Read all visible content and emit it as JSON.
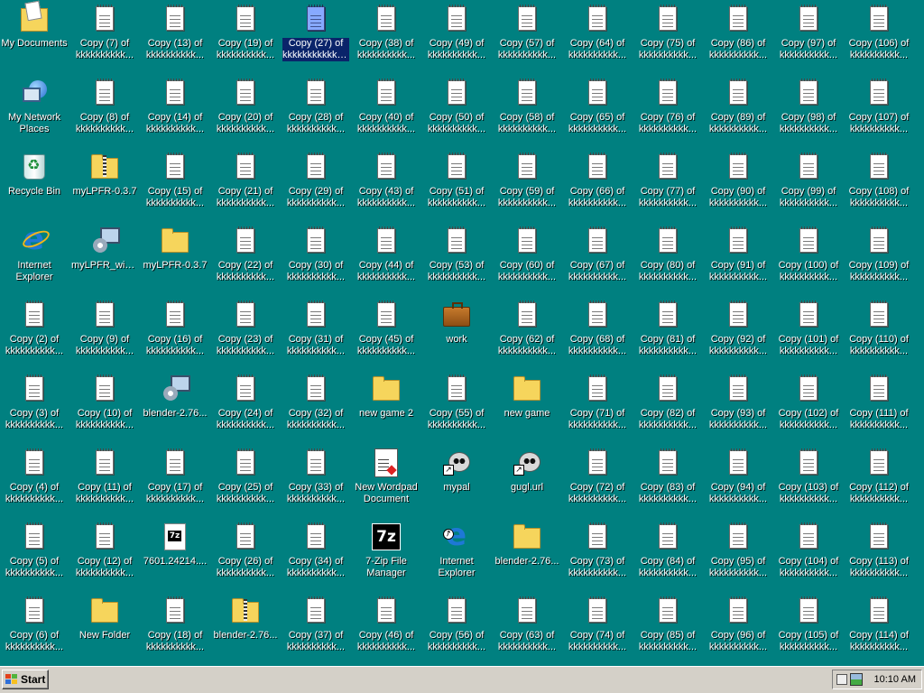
{
  "desktop": {
    "columns": [
      [
        {
          "label": "My Documents",
          "icon": "my-documents-icon"
        },
        {
          "label": "My Network Places",
          "icon": "network-places-icon"
        },
        {
          "label": "Recycle Bin",
          "icon": "recycle-bin-icon"
        },
        {
          "label": "Internet Explorer",
          "icon": "internet-explorer-icon"
        },
        {
          "label": "Copy (2) of kkkkkkkkkk...",
          "icon": "text-document-icon"
        },
        {
          "label": "Copy (3) of kkkkkkkkkk...",
          "icon": "text-document-icon"
        },
        {
          "label": "Copy (4) of kkkkkkkkkk...",
          "icon": "text-document-icon"
        },
        {
          "label": "Copy (5) of kkkkkkkkkk...",
          "icon": "text-document-icon"
        },
        {
          "label": "Copy (6) of kkkkkkkkkk...",
          "icon": "text-document-icon"
        }
      ],
      [
        {
          "label": "Copy (7) of kkkkkkkkkk...",
          "icon": "text-document-icon"
        },
        {
          "label": "Copy (8) of kkkkkkkkkk...",
          "icon": "text-document-icon"
        },
        {
          "label": "myLPFR-0.3.7",
          "icon": "zip-folder-icon"
        },
        {
          "label": "myLPFR_win...",
          "icon": "setup-program-icon"
        },
        {
          "label": "Copy (9) of kkkkkkkkkk...",
          "icon": "text-document-icon"
        },
        {
          "label": "Copy (10) of kkkkkkkkkk...",
          "icon": "text-document-icon"
        },
        {
          "label": "Copy (11) of kkkkkkkkkk...",
          "icon": "text-document-icon"
        },
        {
          "label": "Copy (12) of kkkkkkkkkk...",
          "icon": "text-document-icon"
        },
        {
          "label": "New Folder",
          "icon": "folder-icon"
        }
      ],
      [
        {
          "label": "Copy (13) of kkkkkkkkkk...",
          "icon": "text-document-icon"
        },
        {
          "label": "Copy (14) of kkkkkkkkkk...",
          "icon": "text-document-icon"
        },
        {
          "label": "Copy (15) of kkkkkkkkkk...",
          "icon": "text-document-icon"
        },
        {
          "label": "myLPFR-0.3.7",
          "icon": "folder-icon"
        },
        {
          "label": "Copy (16) of kkkkkkkkkk...",
          "icon": "text-document-icon"
        },
        {
          "label": "blender-2.76...",
          "icon": "setup-program-icon"
        },
        {
          "label": "Copy (17) of kkkkkkkkkk...",
          "icon": "text-document-icon"
        },
        {
          "label": "7601.24214....",
          "icon": "7z-archive-icon"
        },
        {
          "label": "Copy (18) of kkkkkkkkkk...",
          "icon": "text-document-icon"
        }
      ],
      [
        {
          "label": "Copy (19) of kkkkkkkkkk...",
          "icon": "text-document-icon"
        },
        {
          "label": "Copy (20) of kkkkkkkkkk...",
          "icon": "text-document-icon"
        },
        {
          "label": "Copy (21) of kkkkkkkkkk...",
          "icon": "text-document-icon"
        },
        {
          "label": "Copy (22) of kkkkkkkkkk...",
          "icon": "text-document-icon"
        },
        {
          "label": "Copy (23) of kkkkkkkkkk...",
          "icon": "text-document-icon"
        },
        {
          "label": "Copy (24) of kkkkkkkkkk...",
          "icon": "text-document-icon"
        },
        {
          "label": "Copy (25) of kkkkkkkkkk...",
          "icon": "text-document-icon"
        },
        {
          "label": "Copy (26) of kkkkkkkkkk...",
          "icon": "text-document-icon"
        },
        {
          "label": "blender-2.76...",
          "icon": "zip-folder-icon"
        }
      ],
      [
        {
          "label": "Copy (27) of kkkkkkkkkkkk kkkkkkkkkkkk",
          "icon": "text-document-icon",
          "selected": true
        },
        {
          "label": "Copy (28) of kkkkkkkkkk...",
          "icon": "text-document-icon"
        },
        {
          "label": "Copy (29) of kkkkkkkkkk...",
          "icon": "text-document-icon"
        },
        {
          "label": "Copy (30) of kkkkkkkkkk...",
          "icon": "text-document-icon"
        },
        {
          "label": "Copy (31) of kkkkkkkkkk...",
          "icon": "text-document-icon"
        },
        {
          "label": "Copy (32) of kkkkkkkkkk...",
          "icon": "text-document-icon"
        },
        {
          "label": "Copy (33) of kkkkkkkkkk...",
          "icon": "text-document-icon"
        },
        {
          "label": "Copy (34) of kkkkkkkkkk...",
          "icon": "text-document-icon"
        },
        {
          "label": "Copy (37) of kkkkkkkkkk...",
          "icon": "text-document-icon"
        }
      ],
      [
        {
          "label": "Copy (38) of kkkkkkkkkk...",
          "icon": "text-document-icon"
        },
        {
          "label": "Copy (40) of kkkkkkkkkk...",
          "icon": "text-document-icon"
        },
        {
          "label": "Copy (43) of kkkkkkkkkk...",
          "icon": "text-document-icon"
        },
        {
          "label": "Copy (44) of kkkkkkkkkk...",
          "icon": "text-document-icon"
        },
        {
          "label": "Copy (45) of kkkkkkkkkk...",
          "icon": "text-document-icon"
        },
        {
          "label": "new game 2",
          "icon": "folder-icon"
        },
        {
          "label": "New Wordpad Document",
          "icon": "wordpad-document-icon"
        },
        {
          "label": "7-Zip File Manager",
          "icon": "7zip-icon"
        },
        {
          "label": "Copy (46) of kkkkkkkkkk...",
          "icon": "text-document-icon"
        }
      ],
      [
        {
          "label": "Copy (49) of kkkkkkkkkk...",
          "icon": "text-document-icon"
        },
        {
          "label": "Copy (50) of kkkkkkkkkk...",
          "icon": "text-document-icon"
        },
        {
          "label": "Copy (51) of kkkkkkkkkk...",
          "icon": "text-document-icon"
        },
        {
          "label": "Copy (53) of kkkkkkkkkk...",
          "icon": "text-document-icon"
        },
        {
          "label": "work",
          "icon": "briefcase-icon"
        },
        {
          "label": "Copy (55) of kkkkkkkkkk...",
          "icon": "text-document-icon"
        },
        {
          "label": "mypal",
          "icon": "mypal-shortcut-icon"
        },
        {
          "label": "Internet Explorer",
          "icon": "internet-explorer-shortcut-icon"
        },
        {
          "label": "Copy (56) of kkkkkkkkkk...",
          "icon": "text-document-icon"
        }
      ],
      [
        {
          "label": "Copy (57) of kkkkkkkkkk...",
          "icon": "text-document-icon"
        },
        {
          "label": "Copy (58) of kkkkkkkkkk...",
          "icon": "text-document-icon"
        },
        {
          "label": "Copy (59) of kkkkkkkkkk...",
          "icon": "text-document-icon"
        },
        {
          "label": "Copy (60) of kkkkkkkkkk...",
          "icon": "text-document-icon"
        },
        {
          "label": "Copy (62) of kkkkkkkkkk...",
          "icon": "text-document-icon"
        },
        {
          "label": "new game",
          "icon": "folder-icon"
        },
        {
          "label": "gugl.url",
          "icon": "url-shortcut-icon"
        },
        {
          "label": "blender-2.76...",
          "icon": "folder-icon"
        },
        {
          "label": "Copy (63) of kkkkkkkkkk...",
          "icon": "text-document-icon"
        }
      ],
      [
        {
          "label": "Copy (64) of kkkkkkkkkk...",
          "icon": "text-document-icon"
        },
        {
          "label": "Copy (65) of kkkkkkkkkk...",
          "icon": "text-document-icon"
        },
        {
          "label": "Copy (66) of kkkkkkkkkk...",
          "icon": "text-document-icon"
        },
        {
          "label": "Copy (67) of kkkkkkkkkk...",
          "icon": "text-document-icon"
        },
        {
          "label": "Copy (68) of kkkkkkkkkk...",
          "icon": "text-document-icon"
        },
        {
          "label": "Copy (71) of kkkkkkkkkk...",
          "icon": "text-document-icon"
        },
        {
          "label": "Copy (72) of kkkkkkkkkk...",
          "icon": "text-document-icon"
        },
        {
          "label": "Copy (73) of kkkkkkkkkk...",
          "icon": "text-document-icon"
        },
        {
          "label": "Copy (74) of kkkkkkkkkk...",
          "icon": "text-document-icon"
        }
      ],
      [
        {
          "label": "Copy (75) of kkkkkkkkkk...",
          "icon": "text-document-icon"
        },
        {
          "label": "Copy (76) of kkkkkkkkkk...",
          "icon": "text-document-icon"
        },
        {
          "label": "Copy (77) of kkkkkkkkkk...",
          "icon": "text-document-icon"
        },
        {
          "label": "Copy (80) of kkkkkkkkkk...",
          "icon": "text-document-icon"
        },
        {
          "label": "Copy (81) of kkkkkkkkkk...",
          "icon": "text-document-icon"
        },
        {
          "label": "Copy (82) of kkkkkkkkkk...",
          "icon": "text-document-icon"
        },
        {
          "label": "Copy (83) of kkkkkkkkkk...",
          "icon": "text-document-icon"
        },
        {
          "label": "Copy (84) of kkkkkkkkkk...",
          "icon": "text-document-icon"
        },
        {
          "label": "Copy (85) of kkkkkkkkkk...",
          "icon": "text-document-icon"
        }
      ],
      [
        {
          "label": "Copy (86) of kkkkkkkkkk...",
          "icon": "text-document-icon"
        },
        {
          "label": "Copy (89) of kkkkkkkkkk...",
          "icon": "text-document-icon"
        },
        {
          "label": "Copy (90) of kkkkkkkkkk...",
          "icon": "text-document-icon"
        },
        {
          "label": "Copy (91) of kkkkkkkkkk...",
          "icon": "text-document-icon"
        },
        {
          "label": "Copy (92) of kkkkkkkkkk...",
          "icon": "text-document-icon"
        },
        {
          "label": "Copy (93) of kkkkkkkkkk...",
          "icon": "text-document-icon"
        },
        {
          "label": "Copy (94) of kkkkkkkkkk...",
          "icon": "text-document-icon"
        },
        {
          "label": "Copy (95) of kkkkkkkkkk...",
          "icon": "text-document-icon"
        },
        {
          "label": "Copy (96) of kkkkkkkkkk...",
          "icon": "text-document-icon"
        }
      ],
      [
        {
          "label": "Copy (97) of kkkkkkkkkk...",
          "icon": "text-document-icon"
        },
        {
          "label": "Copy (98) of kkkkkkkkkk...",
          "icon": "text-document-icon"
        },
        {
          "label": "Copy (99) of kkkkkkkkkk...",
          "icon": "text-document-icon"
        },
        {
          "label": "Copy (100) of kkkkkkkkkk...",
          "icon": "text-document-icon"
        },
        {
          "label": "Copy (101) of kkkkkkkkkk...",
          "icon": "text-document-icon"
        },
        {
          "label": "Copy (102) of kkkkkkkkkk...",
          "icon": "text-document-icon"
        },
        {
          "label": "Copy (103) of kkkkkkkkkk...",
          "icon": "text-document-icon"
        },
        {
          "label": "Copy (104) of kkkkkkkkkk...",
          "icon": "text-document-icon"
        },
        {
          "label": "Copy (105) of kkkkkkkkkk...",
          "icon": "text-document-icon"
        }
      ],
      [
        {
          "label": "Copy (106) of kkkkkkkkkk...",
          "icon": "text-document-icon"
        },
        {
          "label": "Copy (107) of kkkkkkkkkk...",
          "icon": "text-document-icon"
        },
        {
          "label": "Copy (108) of kkkkkkkkkk...",
          "icon": "text-document-icon"
        },
        {
          "label": "Copy (109) of kkkkkkkkkk...",
          "icon": "text-document-icon"
        },
        {
          "label": "Copy (110) of kkkkkkkkkk...",
          "icon": "text-document-icon"
        },
        {
          "label": "Copy (111) of kkkkkkkkkk...",
          "icon": "text-document-icon"
        },
        {
          "label": "Copy (112) of kkkkkkkkkk...",
          "icon": "text-document-icon"
        },
        {
          "label": "Copy (113) of kkkkkkkkkk...",
          "icon": "text-document-icon"
        },
        {
          "label": "Copy (114) of kkkkkkkkkk...",
          "icon": "text-document-icon"
        }
      ]
    ]
  },
  "taskbar": {
    "start_label": "Start",
    "clock": "10:10 AM"
  },
  "colors": {
    "desktop_background": "#008080",
    "taskbar": "#d4d0c8",
    "selection": "#0a246a"
  }
}
